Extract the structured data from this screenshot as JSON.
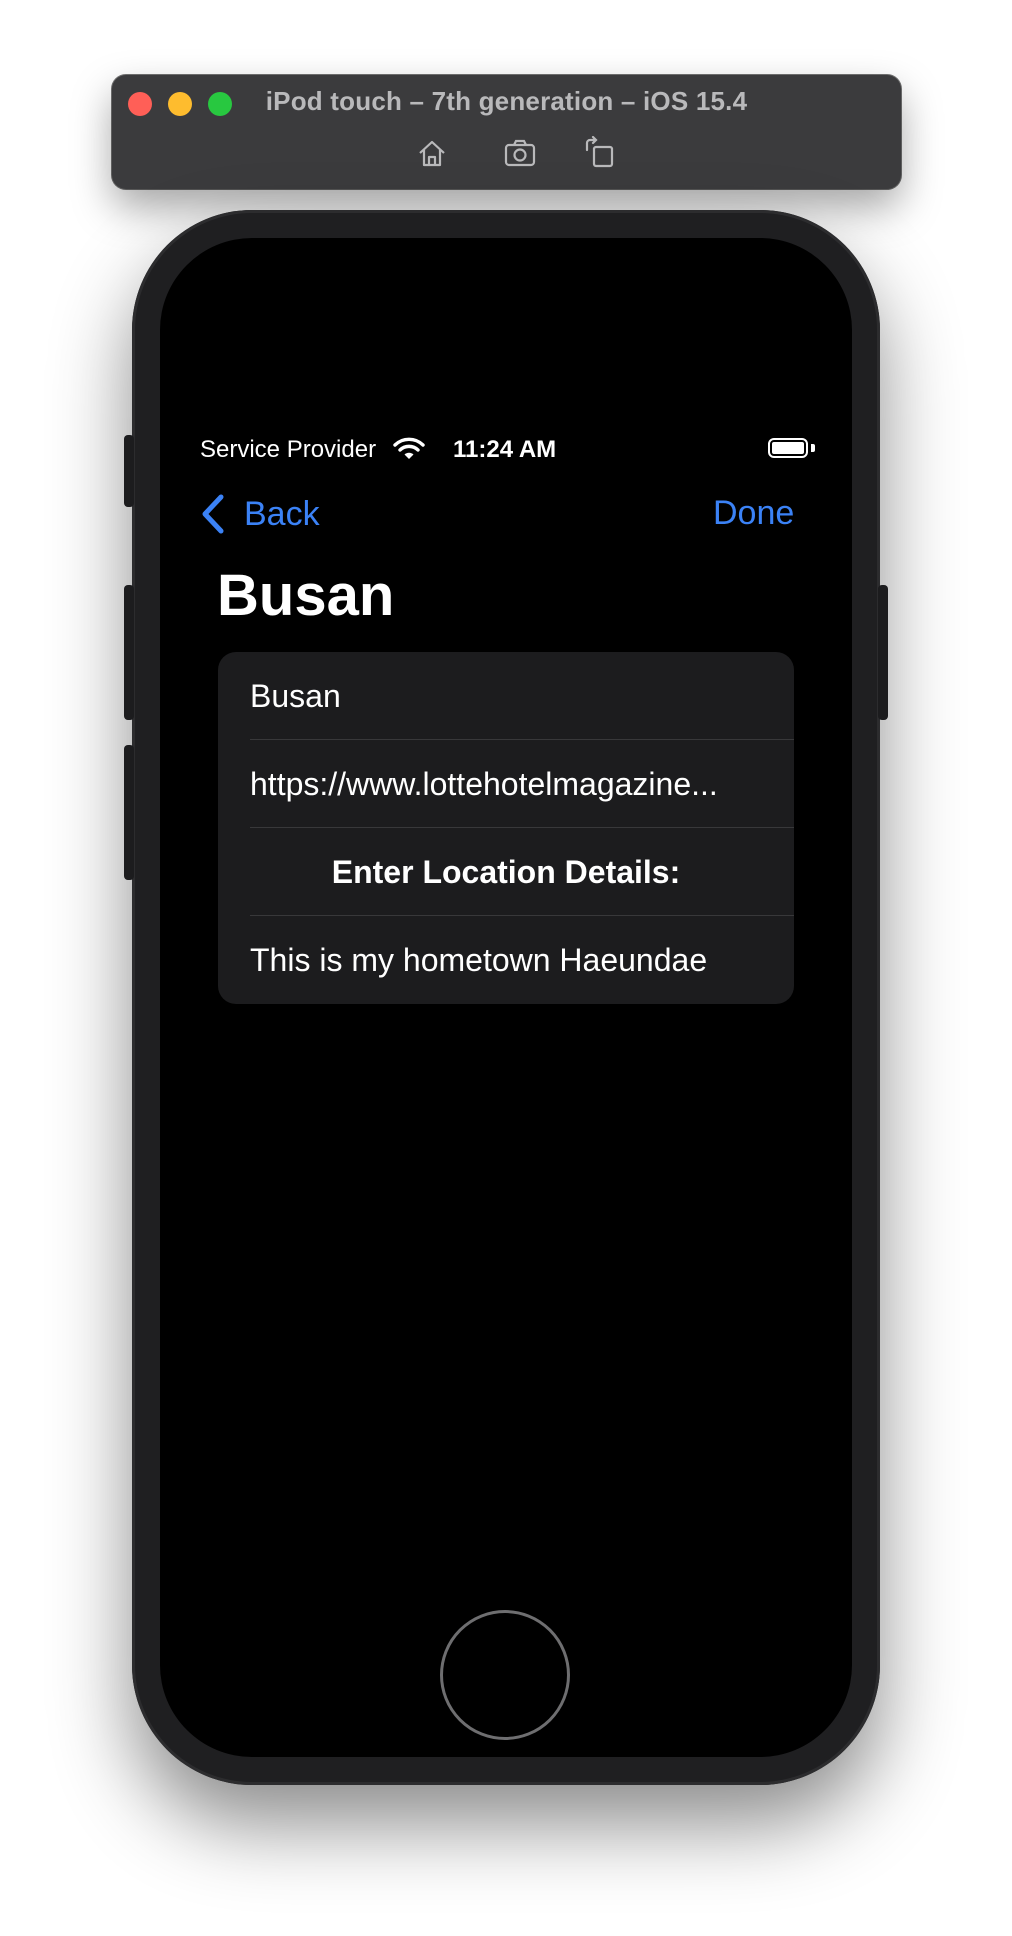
{
  "simulator": {
    "title": "iPod touch – 7th generation – iOS 15.4",
    "tools": [
      "home-icon",
      "screenshot-icon",
      "rotate-icon"
    ]
  },
  "status_bar": {
    "carrier": "Service Provider",
    "time": "11:24 AM",
    "battery_level": 1.0
  },
  "nav": {
    "back_label": "Back",
    "done_label": "Done"
  },
  "page": {
    "title": "Busan"
  },
  "form": {
    "name_value": "Busan",
    "url_value": "https://www.lottehotelmagazine...",
    "details_header": "Enter Location Details:",
    "details_value": "This is my hometown Haeundae"
  },
  "colors": {
    "accent": "#3b82f6",
    "background": "#000000",
    "card": "#1c1c1e"
  }
}
